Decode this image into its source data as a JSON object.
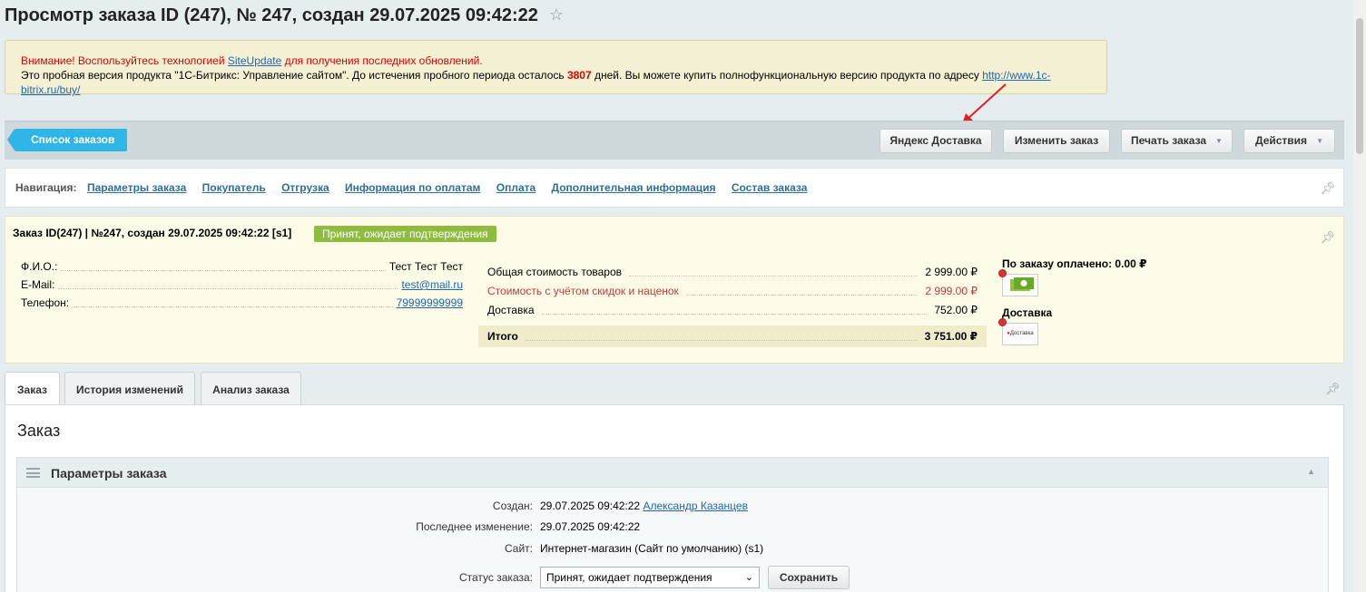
{
  "page": {
    "title": "Просмотр заказа ID (247), № 247, создан 29.07.2025 09:42:22",
    "star_icon": "☆"
  },
  "notice": {
    "line1_pre": "Внимание! Воспользуйтесь технологией ",
    "line1_link": "SiteUpdate",
    "line1_post": " для получения последних обновлений.",
    "line2_pre": "Это пробная версия продукта \"1С-Битрикс: Управление сайтом\". До истечения пробного периода осталось ",
    "days": "3807",
    "line2_mid": " дней. Вы можете купить полнофункциональную версию продукта по адресу ",
    "buy_link": "http://www.1c-bitrix.ru/buy/"
  },
  "toolbar": {
    "back_label": "Список заказов",
    "yandex_delivery": "Яндекс Доставка",
    "edit_order": "Изменить заказ",
    "print_order": "Печать заказа",
    "actions": "Действия",
    "caret": "▼"
  },
  "nav": {
    "label": "Навигация:",
    "links": [
      "Параметры заказа",
      "Покупатель",
      "Отгрузка",
      "Информация по оплатам",
      "Оплата",
      "Дополнительная информация",
      "Состав заказа"
    ]
  },
  "summary": {
    "title": "Заказ ID(247) | №247, создан 29.07.2025 09:42:22 [s1]",
    "status": "Принят, ожидает подтверждения",
    "customer": {
      "fio_label": "Ф.И.О.:",
      "fio": "Тест Тест Тест",
      "email_label": "E-Mail:",
      "email": "test@mail.ru",
      "phone_label": "Телефон:",
      "phone": "79999999999"
    },
    "costs": {
      "goods_label": "Общая стоимость товаров",
      "goods": "2 999.00 ₽",
      "discount_label": "Стоимость с учётом скидок и наценок",
      "discount": "2 999.00 ₽",
      "delivery_label": "Доставка",
      "delivery": "752.00 ₽",
      "total_label": "Итого",
      "total": "3 751.00 ₽"
    },
    "paid": "По заказу оплачено: 0.00 ₽",
    "delivery_title": "Доставка",
    "delivery_logo_text": "Доставка"
  },
  "tabs": [
    "Заказ",
    "История изменений",
    "Анализ заказа"
  ],
  "content": {
    "title": "Заказ",
    "section_title": "Параметры заказа",
    "created_label": "Создан:",
    "created_date": "29.07.2025 09:42:22",
    "created_user": "Александр Казанцев",
    "modified_label": "Последнее изменение:",
    "modified_date": "29.07.2025 09:42:22",
    "site_label": "Сайт:",
    "site_value": "Интернет-магазин (Сайт по умолчанию) (s1)",
    "status_label": "Статус заказа:",
    "status_value": "Принят, ожидает подтверждения",
    "save_label": "Сохранить"
  },
  "colors": {
    "accent": "#2fb6e6",
    "status_green": "#8fbb3f",
    "warning_red": "#dd0000"
  }
}
